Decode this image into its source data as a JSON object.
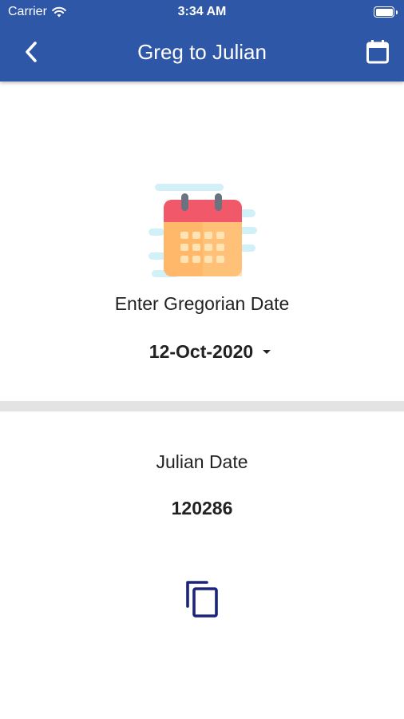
{
  "status_bar": {
    "carrier": "Carrier",
    "time": "3:34 AM"
  },
  "nav": {
    "title": "Greg to Julian",
    "back_icon": "chevron-left-icon",
    "action_icon": "calendar-icon"
  },
  "input_section": {
    "label": "Enter Gregorian Date",
    "selected_date": "12-Oct-2020"
  },
  "result_section": {
    "label": "Julian Date",
    "value": "120286",
    "copy_icon": "copy-icon"
  },
  "colors": {
    "header": "#2f57a8",
    "copy_icon": "#1a237e",
    "divider": "#e3e3e3"
  }
}
